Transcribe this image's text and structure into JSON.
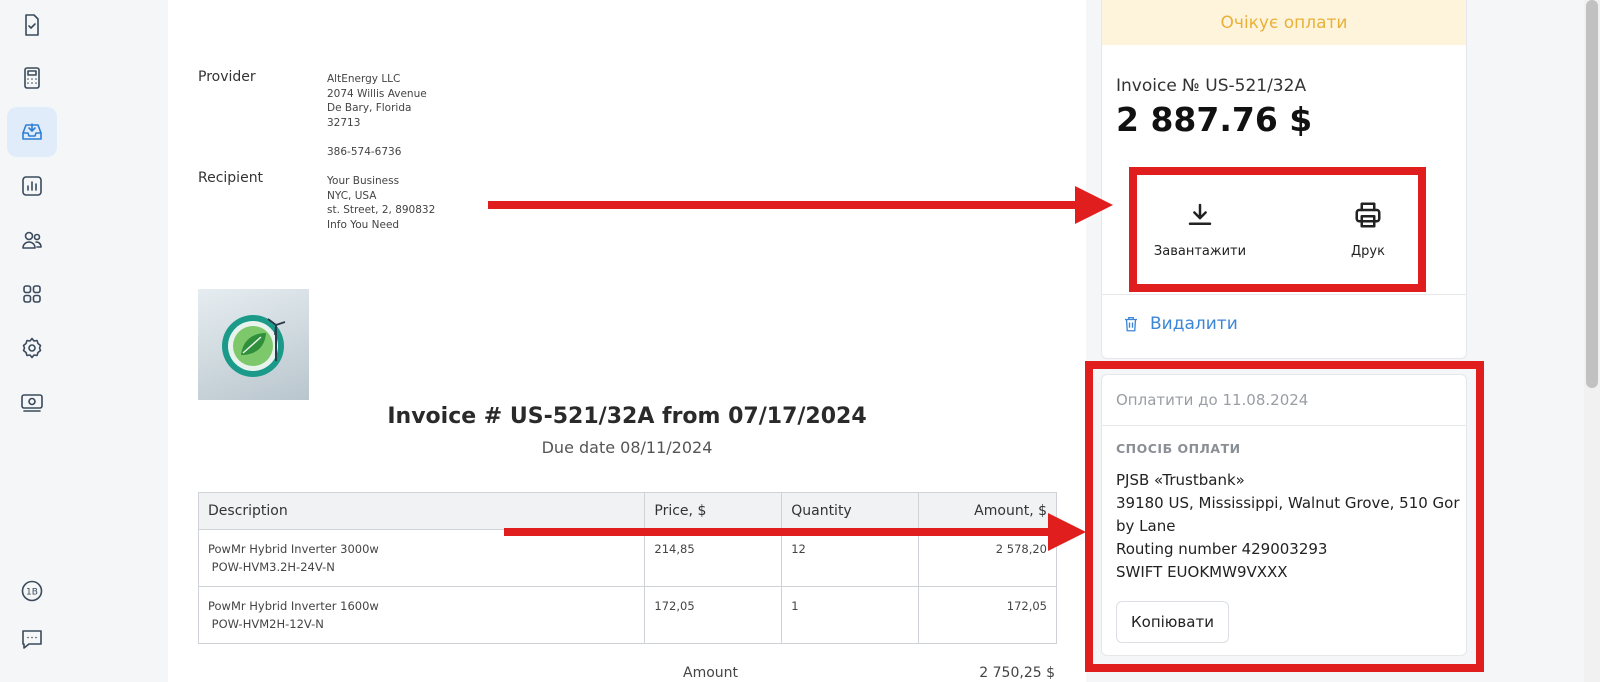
{
  "sidebar": {
    "items": [
      {
        "icon": "document-check-icon"
      },
      {
        "icon": "calculator-icon"
      },
      {
        "icon": "inbox-download-icon",
        "active": true
      },
      {
        "icon": "bar-chart-icon"
      },
      {
        "icon": "users-icon"
      },
      {
        "icon": "apps-grid-icon"
      },
      {
        "icon": "gear-icon"
      },
      {
        "icon": "money-icon"
      },
      {
        "icon": "1b-badge-icon",
        "label": "1B"
      },
      {
        "icon": "chat-icon"
      }
    ]
  },
  "invoice": {
    "provider_label": "Provider",
    "provider_lines": [
      "AltEnergy LLC",
      "2074 Willis Avenue",
      "De Bary, Florida",
      "32713",
      "",
      "386-574-6736"
    ],
    "recipient_label": "Recipient",
    "recipient_lines": [
      "Your Business",
      "NYC, USA",
      "st. Street, 2, 890832",
      "Info You Need"
    ],
    "title": "Invoice # US-521/32A from 07/17/2024",
    "due": "Due date 08/11/2024",
    "table": {
      "headers": [
        "Description",
        "Price, $",
        "Quantity",
        "Amount, $"
      ],
      "rows": [
        {
          "description": "PowMr Hybrid Inverter 3000w",
          "sku": " POW-HVM3.2H-24V-N",
          "price": "214,85",
          "quantity": "12",
          "amount": "2 578,20"
        },
        {
          "description": "PowMr Hybrid Inverter 1600w",
          "sku": " POW-HVM2H-12V-N",
          "price": "172,05",
          "quantity": "1",
          "amount": "172,05"
        }
      ]
    },
    "total_label": "Amount",
    "total_value": "2 750,25 $"
  },
  "card": {
    "status": "Очікує оплати",
    "status_color": "#e8b13a",
    "number": "Invoice № US-521/32A",
    "amount": "2 887.76 $",
    "download_label": "Завантажити",
    "print_label": "Друк",
    "delete_label": "Видалити",
    "accent_color": "#3c86d8"
  },
  "payment": {
    "due": "Оплатити до 11.08.2024",
    "heading": "СПОСІБ ОПЛАТИ",
    "lines": [
      "PJSB «Trustbank»",
      "39180 US, Mississippi, Walnut Grove, 510 Gorby Lane",
      "Routing number 429003293",
      "SWIFT EUOKMW9VXXX"
    ],
    "copy_label": "Копіювати"
  },
  "annotation_color": "#e01e1e"
}
